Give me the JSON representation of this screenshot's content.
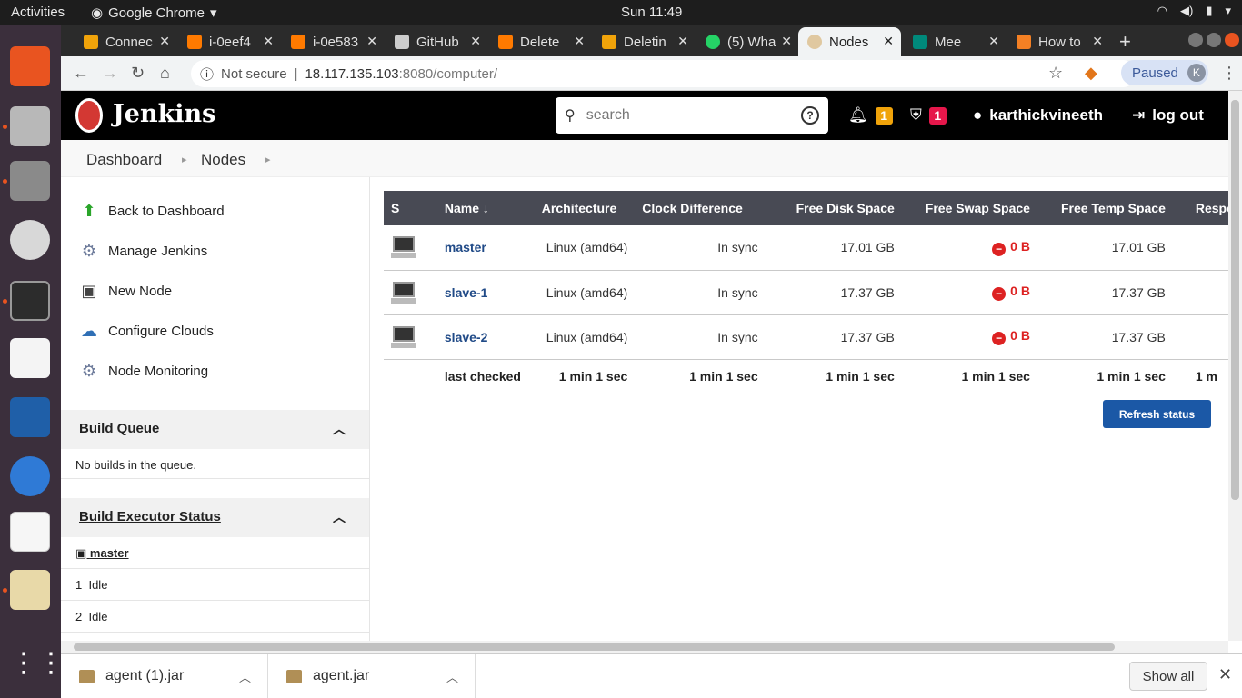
{
  "os": {
    "activities": "Activities",
    "app_name": "Google Chrome",
    "clock": "Sun 11:49"
  },
  "tabs": [
    {
      "label": "Connec",
      "color": "#f0a30a"
    },
    {
      "label": "i-0eef4",
      "color": "#ff7a00"
    },
    {
      "label": "i-0e583",
      "color": "#ff7a00"
    },
    {
      "label": "GitHub",
      "color": "#cccccc"
    },
    {
      "label": "Delete",
      "color": "#ff7a00"
    },
    {
      "label": "Deletin",
      "color": "#f0a30a"
    },
    {
      "label": "(5) Wha",
      "color": "#25d366"
    },
    {
      "label": "Nodes",
      "color": "#e0c8a0"
    },
    {
      "label": "Mee",
      "color": "#00897b"
    },
    {
      "label": "How to",
      "color": "#f48024"
    }
  ],
  "address": {
    "security": "Not secure",
    "url_host": "18.117.135.103",
    "url_rest": ":8080/computer/",
    "profile_status": "Paused",
    "profile_initial": "K"
  },
  "jenkins": {
    "brand": "Jenkins",
    "search_placeholder": "search",
    "notifications_count": "1",
    "security_count": "1",
    "username": "karthickvineeth",
    "logout": "log out"
  },
  "breadcrumb": [
    "Dashboard",
    "Nodes"
  ],
  "sidebar": {
    "tasks": [
      {
        "label": "Back to Dashboard",
        "icon": "up-arrow-icon"
      },
      {
        "label": "Manage Jenkins",
        "icon": "gear-icon"
      },
      {
        "label": "New Node",
        "icon": "computer-icon"
      },
      {
        "label": "Configure Clouds",
        "icon": "cloud-icon"
      },
      {
        "label": "Node Monitoring",
        "icon": "gear-icon"
      }
    ],
    "build_queue": {
      "title": "Build Queue",
      "empty": "No builds in the queue."
    },
    "executor_status": {
      "title": "Build Executor Status",
      "node": "master",
      "executors": [
        {
          "num": "1",
          "state": "Idle"
        },
        {
          "num": "2",
          "state": "Idle"
        }
      ]
    }
  },
  "table": {
    "headers": [
      "S",
      "Name ↓",
      "Architecture",
      "Clock Difference",
      "Free Disk Space",
      "Free Swap Space",
      "Free Temp Space",
      "Respons"
    ],
    "rows": [
      {
        "name": "master",
        "arch": "Linux (amd64)",
        "clock": "In sync",
        "disk": "17.01 GB",
        "swap": "0 B",
        "temp": "17.01 GB"
      },
      {
        "name": "slave-1",
        "arch": "Linux (amd64)",
        "clock": "In sync",
        "disk": "17.37 GB",
        "swap": "0 B",
        "temp": "17.37 GB"
      },
      {
        "name": "slave-2",
        "arch": "Linux (amd64)",
        "clock": "In sync",
        "disk": "17.37 GB",
        "swap": "0 B",
        "temp": "17.37 GB"
      }
    ],
    "last_checked": {
      "label": "last checked",
      "values": [
        "1 min 1 sec",
        "1 min 1 sec",
        "1 min 1 sec",
        "1 min 1 sec",
        "1 min 1 sec",
        "1 m"
      ]
    },
    "refresh": "Refresh status"
  },
  "downloads": {
    "items": [
      "agent (1).jar",
      "agent.jar"
    ],
    "show_all": "Show all"
  }
}
